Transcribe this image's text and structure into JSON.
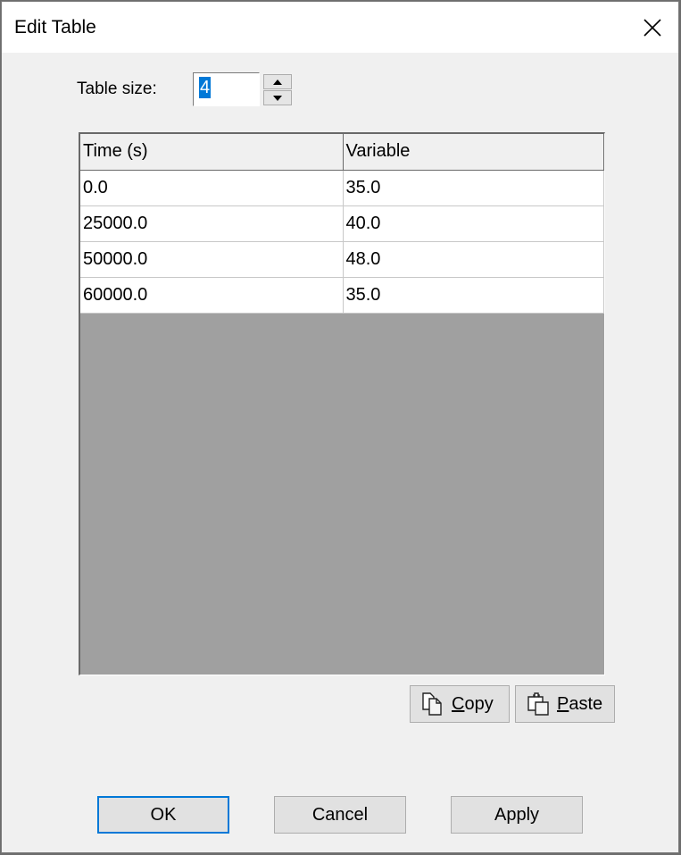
{
  "window": {
    "title": "Edit Table",
    "close_icon": "close-icon"
  },
  "table_size": {
    "label": "Table size:",
    "value": "4",
    "spin_up_icon": "triangle-up-icon",
    "spin_down_icon": "triangle-down-icon"
  },
  "table": {
    "columns": [
      "Time (s)",
      "Variable"
    ],
    "rows": [
      [
        "0.0",
        "35.0"
      ],
      [
        "25000.0",
        "40.0"
      ],
      [
        "50000.0",
        "48.0"
      ],
      [
        "60000.0",
        "35.0"
      ]
    ]
  },
  "clipboard": {
    "copy": {
      "mnemonic": "C",
      "rest": "opy",
      "icon": "copy-icon"
    },
    "paste": {
      "mnemonic": "P",
      "rest": "aste",
      "icon": "paste-icon"
    }
  },
  "buttons": {
    "ok": "OK",
    "cancel": "Cancel",
    "apply": "Apply"
  },
  "colors": {
    "accent": "#0078d7",
    "empty_grid": "#a0a0a0"
  }
}
